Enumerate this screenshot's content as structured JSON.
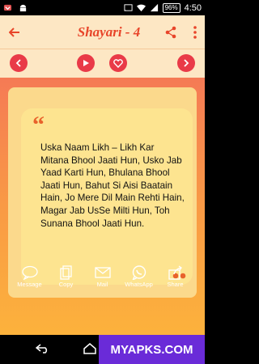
{
  "status": {
    "battery": "96%",
    "time": "4:50"
  },
  "appbar": {
    "title": "Shayari - 4"
  },
  "quote": {
    "text": "Uska Naam Likh – Likh Kar Mitana Bhool Jaati Hun, Usko Jab Yaad Karti Hun, Bhulana Bhool Jaati Hun, Bahut Si Aisi Baatain Hain, Jo Mere Dil Main Rehti Hain, Magar Jab UsSe Milti Hun, Toh Sunana Bhool Jaati Hun.",
    "open_mark": "“"
  },
  "actions": [
    {
      "label": "Message",
      "icon": "message-icon"
    },
    {
      "label": "Copy",
      "icon": "copy-icon"
    },
    {
      "label": "Mail",
      "icon": "mail-icon"
    },
    {
      "label": "WhatsApp",
      "icon": "whatsapp-icon"
    },
    {
      "label": "Share",
      "icon": "share-icon"
    }
  ],
  "watermark": "MYAPKS.COM",
  "colors": {
    "appbar": "#fde7c4",
    "accent": "#e93a48",
    "title": "#e8452a",
    "card": "#fde490"
  }
}
